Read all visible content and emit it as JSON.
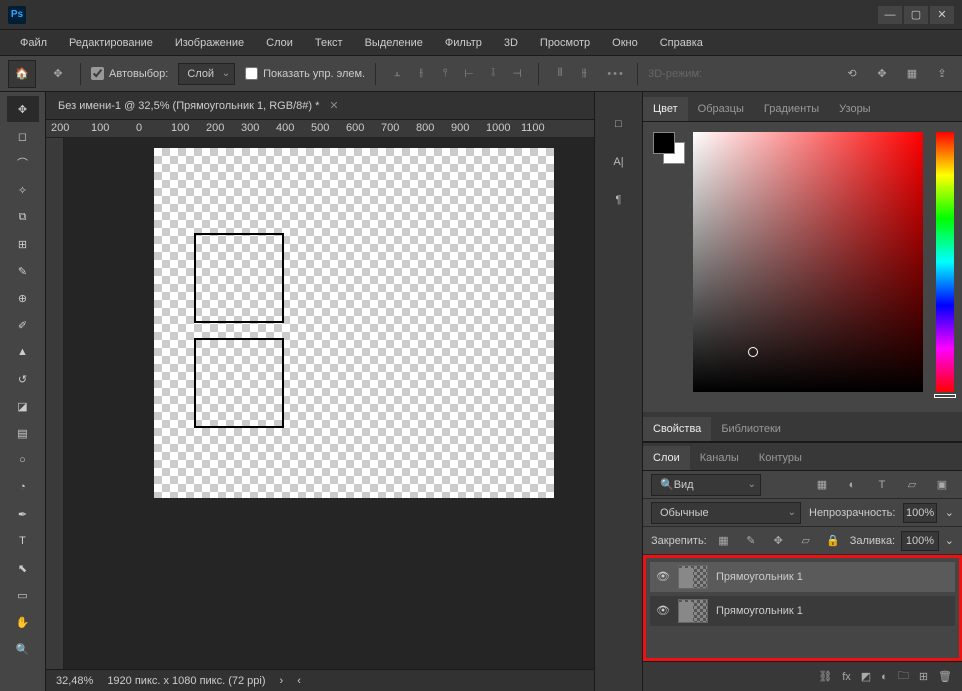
{
  "menubar": [
    "Файл",
    "Редактирование",
    "Изображение",
    "Слои",
    "Текст",
    "Выделение",
    "Фильтр",
    "3D",
    "Просмотр",
    "Окно",
    "Справка"
  ],
  "options": {
    "autoselect": "Автовыбор:",
    "autoselect_target": "Слой",
    "show_controls": "Показать упр. элем.",
    "mode3d": "3D-режим:"
  },
  "doc": {
    "tab": "Без имени-1 @ 32,5% (Прямоугольник 1, RGB/8#) *",
    "ruler_ticks": [
      "200",
      "100",
      "0",
      "100",
      "200",
      "300",
      "400",
      "500",
      "600",
      "700",
      "800",
      "900",
      "1000",
      "1100"
    ]
  },
  "status": {
    "zoom": "32,48%",
    "dims": "1920 пикс. x 1080 пикс. (72 ppi)"
  },
  "panels": {
    "color_tabs": [
      "Цвет",
      "Образцы",
      "Градиенты",
      "Узоры"
    ],
    "props_tabs": [
      "Свойства",
      "Библиотеки"
    ],
    "layer_tabs": [
      "Слои",
      "Каналы",
      "Контуры"
    ],
    "search": "Вид",
    "blend": "Обычные",
    "opacity_label": "Непрозрачность:",
    "opacity": "100%",
    "lock_label": "Закрепить:",
    "fill_label": "Заливка:",
    "fill": "100%",
    "layers": [
      {
        "name": "Прямоугольник 1"
      },
      {
        "name": "Прямоугольник 1"
      }
    ]
  }
}
